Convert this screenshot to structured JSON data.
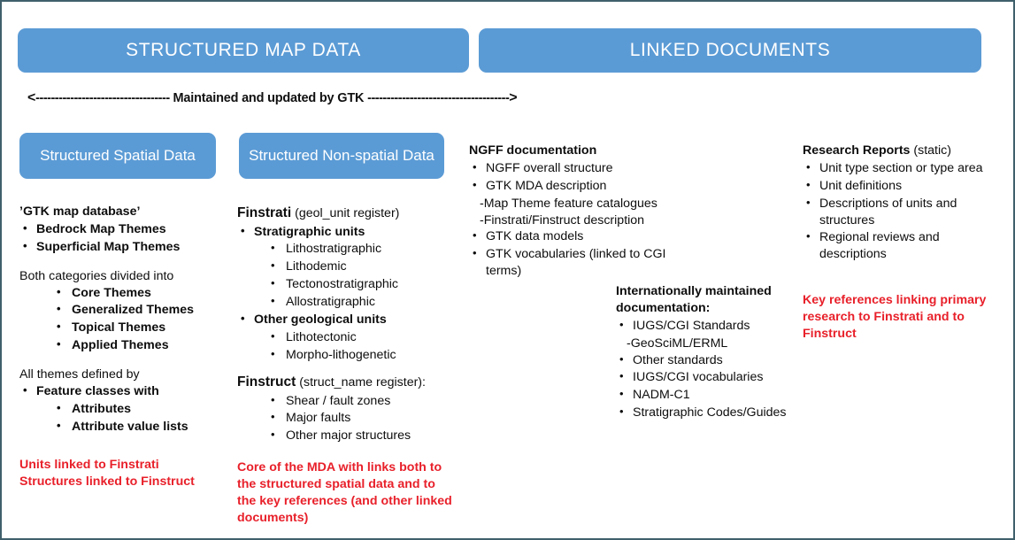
{
  "theme": {
    "pill_blue": "#5b9bd5",
    "border": "#3f5f6b",
    "red": "#e8202a",
    "text": "#0d0d0d"
  },
  "headers": {
    "left": "STRUCTURED MAP DATA",
    "right": "LINKED DOCUMENTS"
  },
  "arrow": {
    "left_cap": "<",
    "dashes_left": "-----------------------------------",
    "label": "Maintained and updated by GTK",
    "dashes_right": "-------------------------------------",
    "right_cap": ">"
  },
  "col1": {
    "pill": "Structured Spatial Data",
    "title": "’GTK map database’",
    "items": [
      "Bedrock Map Themes",
      "Superficial Map Themes"
    ],
    "sub_intro": "Both categories divided into",
    "sub_items": [
      "Core Themes",
      "Generalized Themes",
      "Topical Themes",
      "Applied Themes"
    ],
    "defined_intro": "All themes defined by",
    "defined_item": "Feature classes with",
    "defined_subitems": [
      "Attributes",
      "Attribute value lists"
    ],
    "note_line1": "Units linked to Finstrati",
    "note_line2": "Structures linked to Finstruct"
  },
  "col2": {
    "pill": "Structured Non-spatial Data",
    "finstrati_title_bold": "Finstrati",
    "finstrati_title_norm": "(geol_unit register)",
    "strat_group": "Stratigraphic units",
    "strat_items": [
      "Lithostratigraphic",
      "Lithodemic",
      "Tectonostratigraphic",
      "Allostratigraphic"
    ],
    "other_group": "Other geological units",
    "other_items": [
      "Lithotectonic",
      "Morpho-lithogenetic"
    ],
    "finstruct_title_bold": "Finstruct",
    "finstruct_title_norm": "(struct_name register):",
    "finstruct_items": [
      "Shear / fault zones",
      "Major faults",
      "Other major structures"
    ],
    "note": "Core of the MDA with links both to the structured spatial data and to the key references (and other linked documents)"
  },
  "col3": {
    "title": "NGFF documentation",
    "items": [
      "NGFF overall structure",
      "GTK MDA description"
    ],
    "dash_items": [
      "-Map Theme feature catalogues",
      "-Finstrati/Finstruct description"
    ],
    "items2": [
      "GTK data models",
      "GTK vocabularies (linked to CGI terms)"
    ],
    "intl_title_line1": "Internationally maintained",
    "intl_title_line2": "documentation:",
    "intl_items": [
      "IUGS/CGI Standards"
    ],
    "intl_dash": "-GeoSciML/ERML",
    "intl_items2": [
      "Other standards",
      "IUGS/CGI vocabularies",
      "NADM-C1",
      "Stratigraphic Codes/Guides"
    ]
  },
  "col4": {
    "title_bold": "Research Reports",
    "title_norm": "(static)",
    "items": [
      "Unit type section or type area",
      "Unit definitions",
      "Descriptions of units and structures",
      "Regional reviews and descriptions"
    ],
    "note": "Key references linking primary research to Finstrati and to Finstruct"
  }
}
